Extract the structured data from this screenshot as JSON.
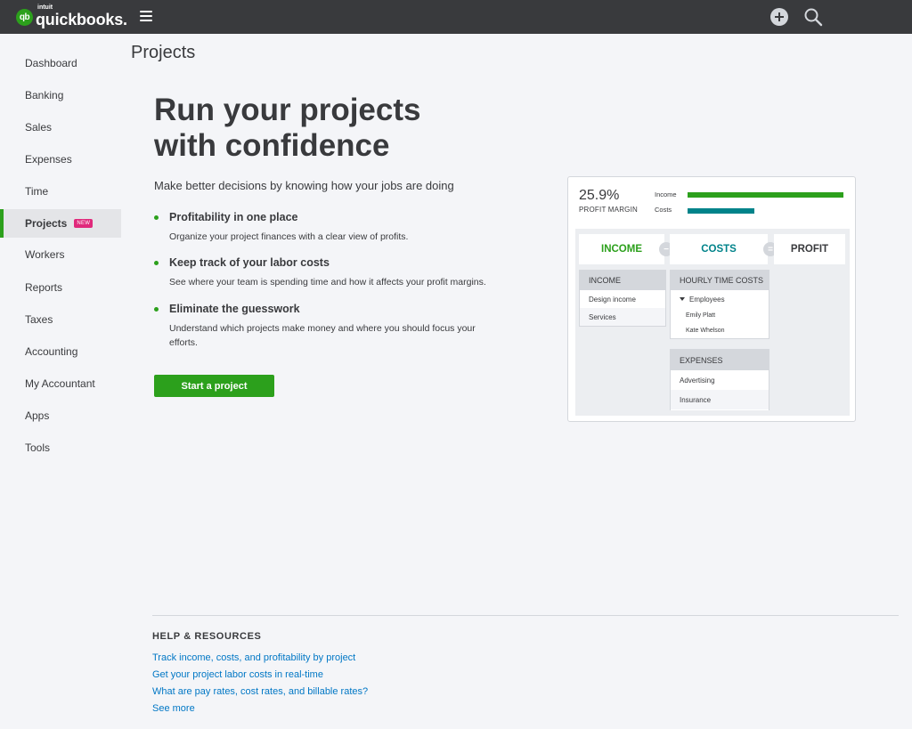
{
  "topbar": {
    "logo_badge": "qb",
    "logo_brand": "intuit",
    "logo_name": "quickbooks."
  },
  "sidebar": {
    "items": [
      {
        "label": "Dashboard"
      },
      {
        "label": "Banking"
      },
      {
        "label": "Sales"
      },
      {
        "label": "Expenses"
      },
      {
        "label": "Time"
      },
      {
        "label": "Projects",
        "badge": "NEW"
      },
      {
        "label": "Workers"
      },
      {
        "label": "Reports"
      },
      {
        "label": "Taxes"
      },
      {
        "label": "Accounting"
      },
      {
        "label": "My Accountant"
      },
      {
        "label": "Apps"
      },
      {
        "label": "Tools"
      }
    ]
  },
  "main": {
    "page_title": "Projects",
    "hero_line1": "Run your projects",
    "hero_line2": "with confidence",
    "subtitle": "Make better decisions by knowing how your jobs are doing",
    "features": [
      {
        "title": "Profitability in one place",
        "desc": "Organize your project finances with a clear view of profits."
      },
      {
        "title": "Keep track of your labor costs",
        "desc": "See where your team is spending time and how it affects your profit margins."
      },
      {
        "title": "Eliminate the guesswork",
        "desc": "Understand which projects make money and where you should focus your efforts."
      }
    ],
    "cta": "Start a project"
  },
  "illustration": {
    "profit_margin_value": "25.9%",
    "profit_margin_label": "PROFIT MARGIN",
    "income_label": "Income",
    "costs_label": "Costs",
    "income_bar": 1.0,
    "costs_bar": 0.43,
    "eq_income": "INCOME",
    "eq_minus": "−",
    "eq_costs": "COSTS",
    "eq_equals": "=",
    "eq_profit": "PROFIT",
    "income_card": {
      "header": "INCOME",
      "rows": [
        "Design income",
        "Services"
      ]
    },
    "hourly_card": {
      "header": "HOURLY TIME COSTS",
      "group": "Employees",
      "rows": [
        "Emily Platt",
        "Kate Whelson"
      ]
    },
    "expenses_card": {
      "header": "EXPENSES",
      "rows": [
        "Advertising",
        "Insurance"
      ]
    }
  },
  "help": {
    "title": "HELP & RESOURCES",
    "links": [
      "Track income, costs, and profitability by project",
      "Get your project labor costs in real-time",
      "What are pay rates, cost rates, and billable rates?",
      "See more"
    ]
  },
  "colors": {
    "brand_green": "#2ca01c",
    "costs_teal": "#00838a",
    "link_blue": "#0077c5",
    "topbar": "#393a3d",
    "new_badge": "#e0297b"
  }
}
